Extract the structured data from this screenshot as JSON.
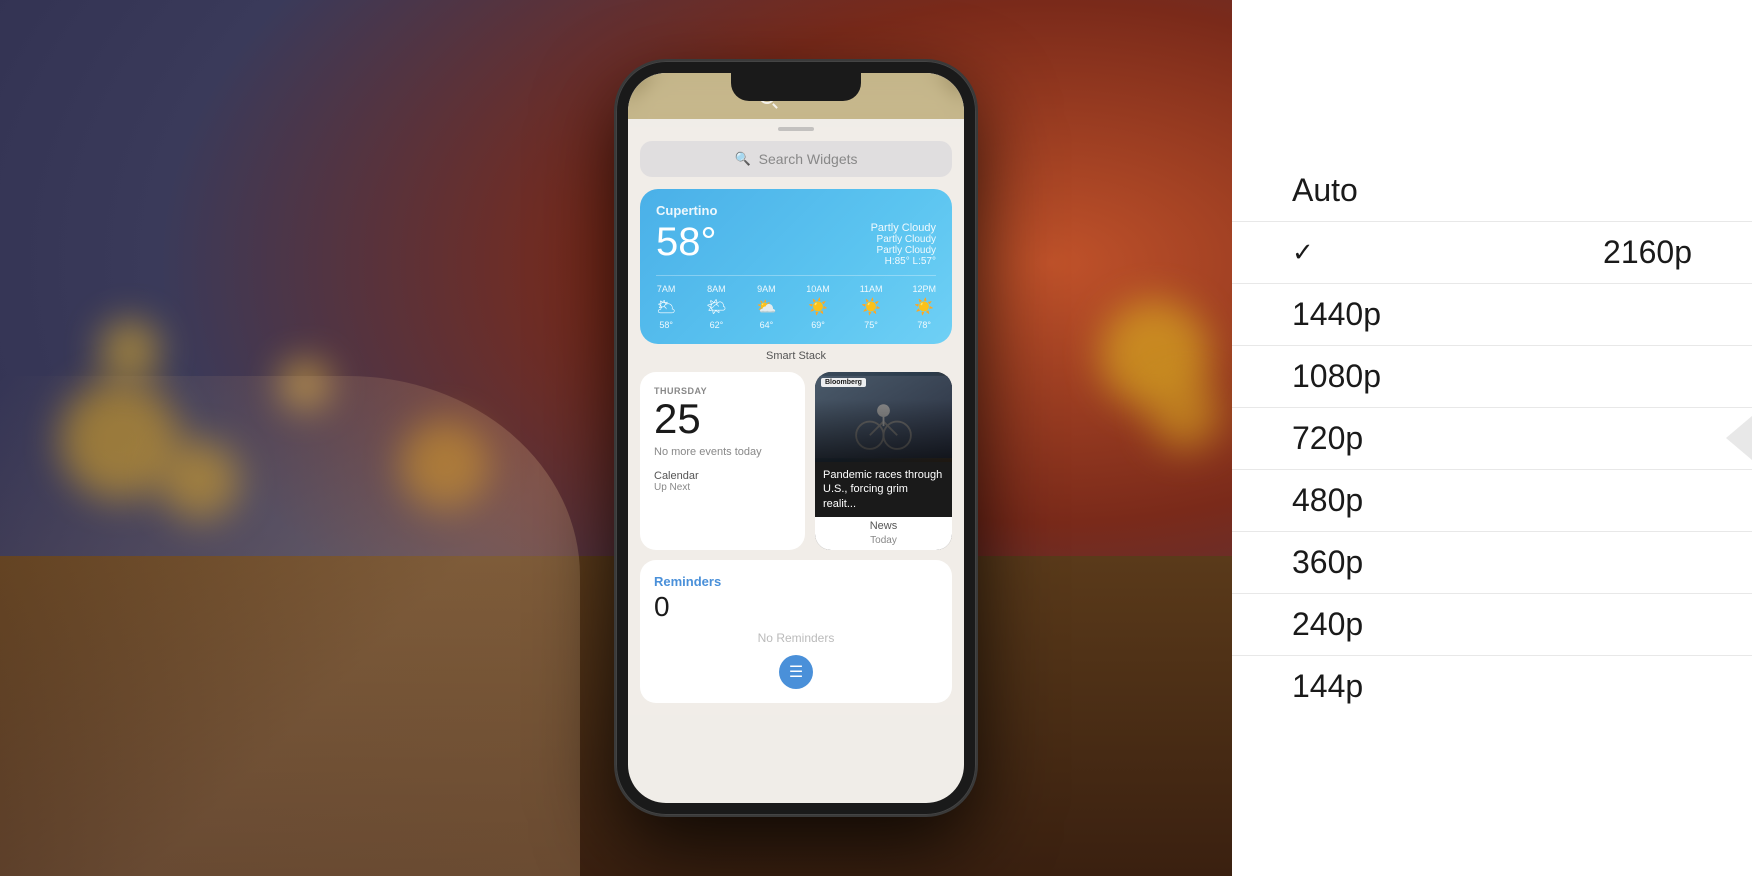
{
  "background": {
    "colors": [
      "#c0522a",
      "#7a2a1a",
      "#3a3a5a",
      "#2a2a4a"
    ]
  },
  "phone": {
    "search_bar": {
      "text": "Search",
      "placeholder": "Search"
    },
    "search_widgets": {
      "text": "Search Widgets"
    },
    "smart_stack_label": "Smart Stack",
    "weather": {
      "location": "Cupertino",
      "temp": "58°",
      "condition": "Partly Cloudy",
      "high": "H:85°",
      "low": "L:57°",
      "hourly": [
        {
          "time": "7AM",
          "icon": "🌥",
          "temp": "58°"
        },
        {
          "time": "8AM",
          "icon": "🌤",
          "temp": "62°"
        },
        {
          "time": "9AM",
          "icon": "⛅",
          "temp": "64°"
        },
        {
          "time": "10AM",
          "icon": "☀",
          "temp": "69°"
        },
        {
          "time": "11AM",
          "icon": "☀",
          "temp": "75°"
        },
        {
          "time": "12PM",
          "icon": "☀",
          "temp": "78°"
        }
      ]
    },
    "calendar": {
      "day": "Thursday",
      "date": "25",
      "no_events": "No more events today",
      "label": "Calendar",
      "sublabel": "Up Next"
    },
    "news": {
      "source": "Bloomberg",
      "headline": "Pandemic races through U.S., forcing grim realit...",
      "label": "News",
      "sublabel": "Today"
    },
    "reminders": {
      "title": "Reminders",
      "count": "0",
      "no_reminders": "No Reminders",
      "label": "Reminders"
    }
  },
  "quality_menu": {
    "items": [
      {
        "label": "Auto",
        "selected": false
      },
      {
        "label": "2160p",
        "selected": true
      },
      {
        "label": "1440p",
        "selected": false
      },
      {
        "label": "1080p",
        "selected": false
      },
      {
        "label": "720p",
        "selected": false
      },
      {
        "label": "480p",
        "selected": false
      },
      {
        "label": "360p",
        "selected": false
      },
      {
        "label": "240p",
        "selected": false
      },
      {
        "label": "144p",
        "selected": false
      }
    ]
  }
}
